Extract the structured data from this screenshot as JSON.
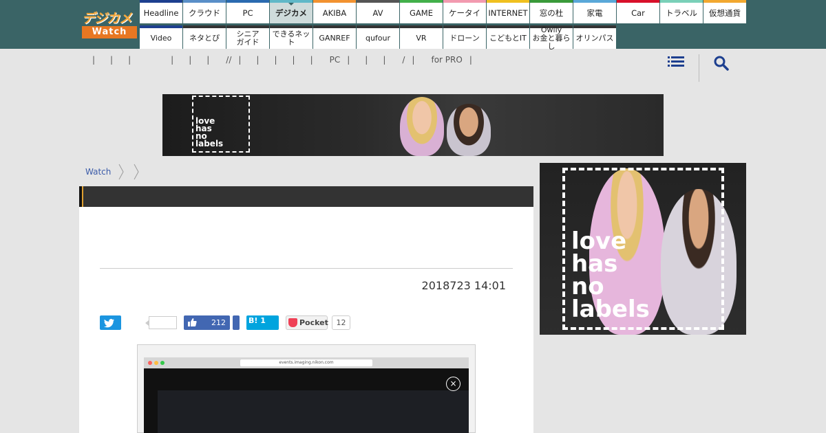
{
  "logo": {
    "top": "デジカメ",
    "bottom": "Watch"
  },
  "nav": {
    "row1": [
      {
        "label": "Headline",
        "color": "#1d3f8f"
      },
      {
        "label": "クラウド",
        "color": "#5a8fc8"
      },
      {
        "label": "PC",
        "color": "#2a6ab0"
      },
      {
        "label": "デジカメ",
        "color": "#60b8c8"
      },
      {
        "label": "AKIBA",
        "color": "#f29230"
      },
      {
        "label": "AV",
        "color": "#555555"
      },
      {
        "label": "GAME",
        "color": "#42b04a"
      },
      {
        "label": "ケータイ",
        "color": "#f29ab0"
      },
      {
        "label": "INTERNET",
        "color": "#f0c020"
      },
      {
        "label": "窓の杜",
        "color": "#3a9a3a"
      },
      {
        "label": "家電",
        "color": "#5aa8d8"
      },
      {
        "label": "Car",
        "color": "#d8102a"
      },
      {
        "label": "トラベル",
        "color": "#7ad0b8"
      },
      {
        "label": "仮想通貨",
        "color": "#f2a830"
      }
    ],
    "row2": [
      {
        "label": "Video",
        "color": "#1d3f8f"
      },
      {
        "label": "ネタとぴ",
        "color": "#333333"
      },
      {
        "label": "シニア\nガイド",
        "color": "#333333"
      },
      {
        "label": "できるネット",
        "color": "#333333"
      },
      {
        "label": "GANREF",
        "color": "#333333"
      },
      {
        "label": "qufour",
        "color": "#333333"
      },
      {
        "label": "VR",
        "color": "#333333"
      },
      {
        "label": "ドローン",
        "color": "#333333"
      },
      {
        "label": "こどもとIT",
        "color": "#333333"
      },
      {
        "label": "Owlly\nお金と暮らし",
        "color": "#333333"
      },
      {
        "label": "オリンパス",
        "color": "#333333"
      }
    ]
  },
  "subnav": [
    "|",
    "|",
    "|",
    "|",
    "|",
    "|",
    "//",
    "|",
    "|",
    "|",
    "|",
    "|",
    "PC",
    "|",
    "|",
    "|",
    "/",
    "|",
    "for PRO",
    "|"
  ],
  "ad": {
    "line1": "love",
    "line2": "has",
    "line3": "no",
    "line4": "labels"
  },
  "breadcrumb": {
    "home": "Watch"
  },
  "article": {
    "date": "2018723 14:01"
  },
  "share": {
    "facebook_count": "212",
    "hatena_label": "B! 1",
    "pocket_label": "Pocket",
    "pocket_count": "12"
  },
  "screenshot": {
    "url": "events.imaging.nikon.com",
    "close": "×"
  },
  "colors": {
    "header_bg": "#3a6466",
    "accent": "#e87722",
    "link": "#3a5aa8"
  }
}
